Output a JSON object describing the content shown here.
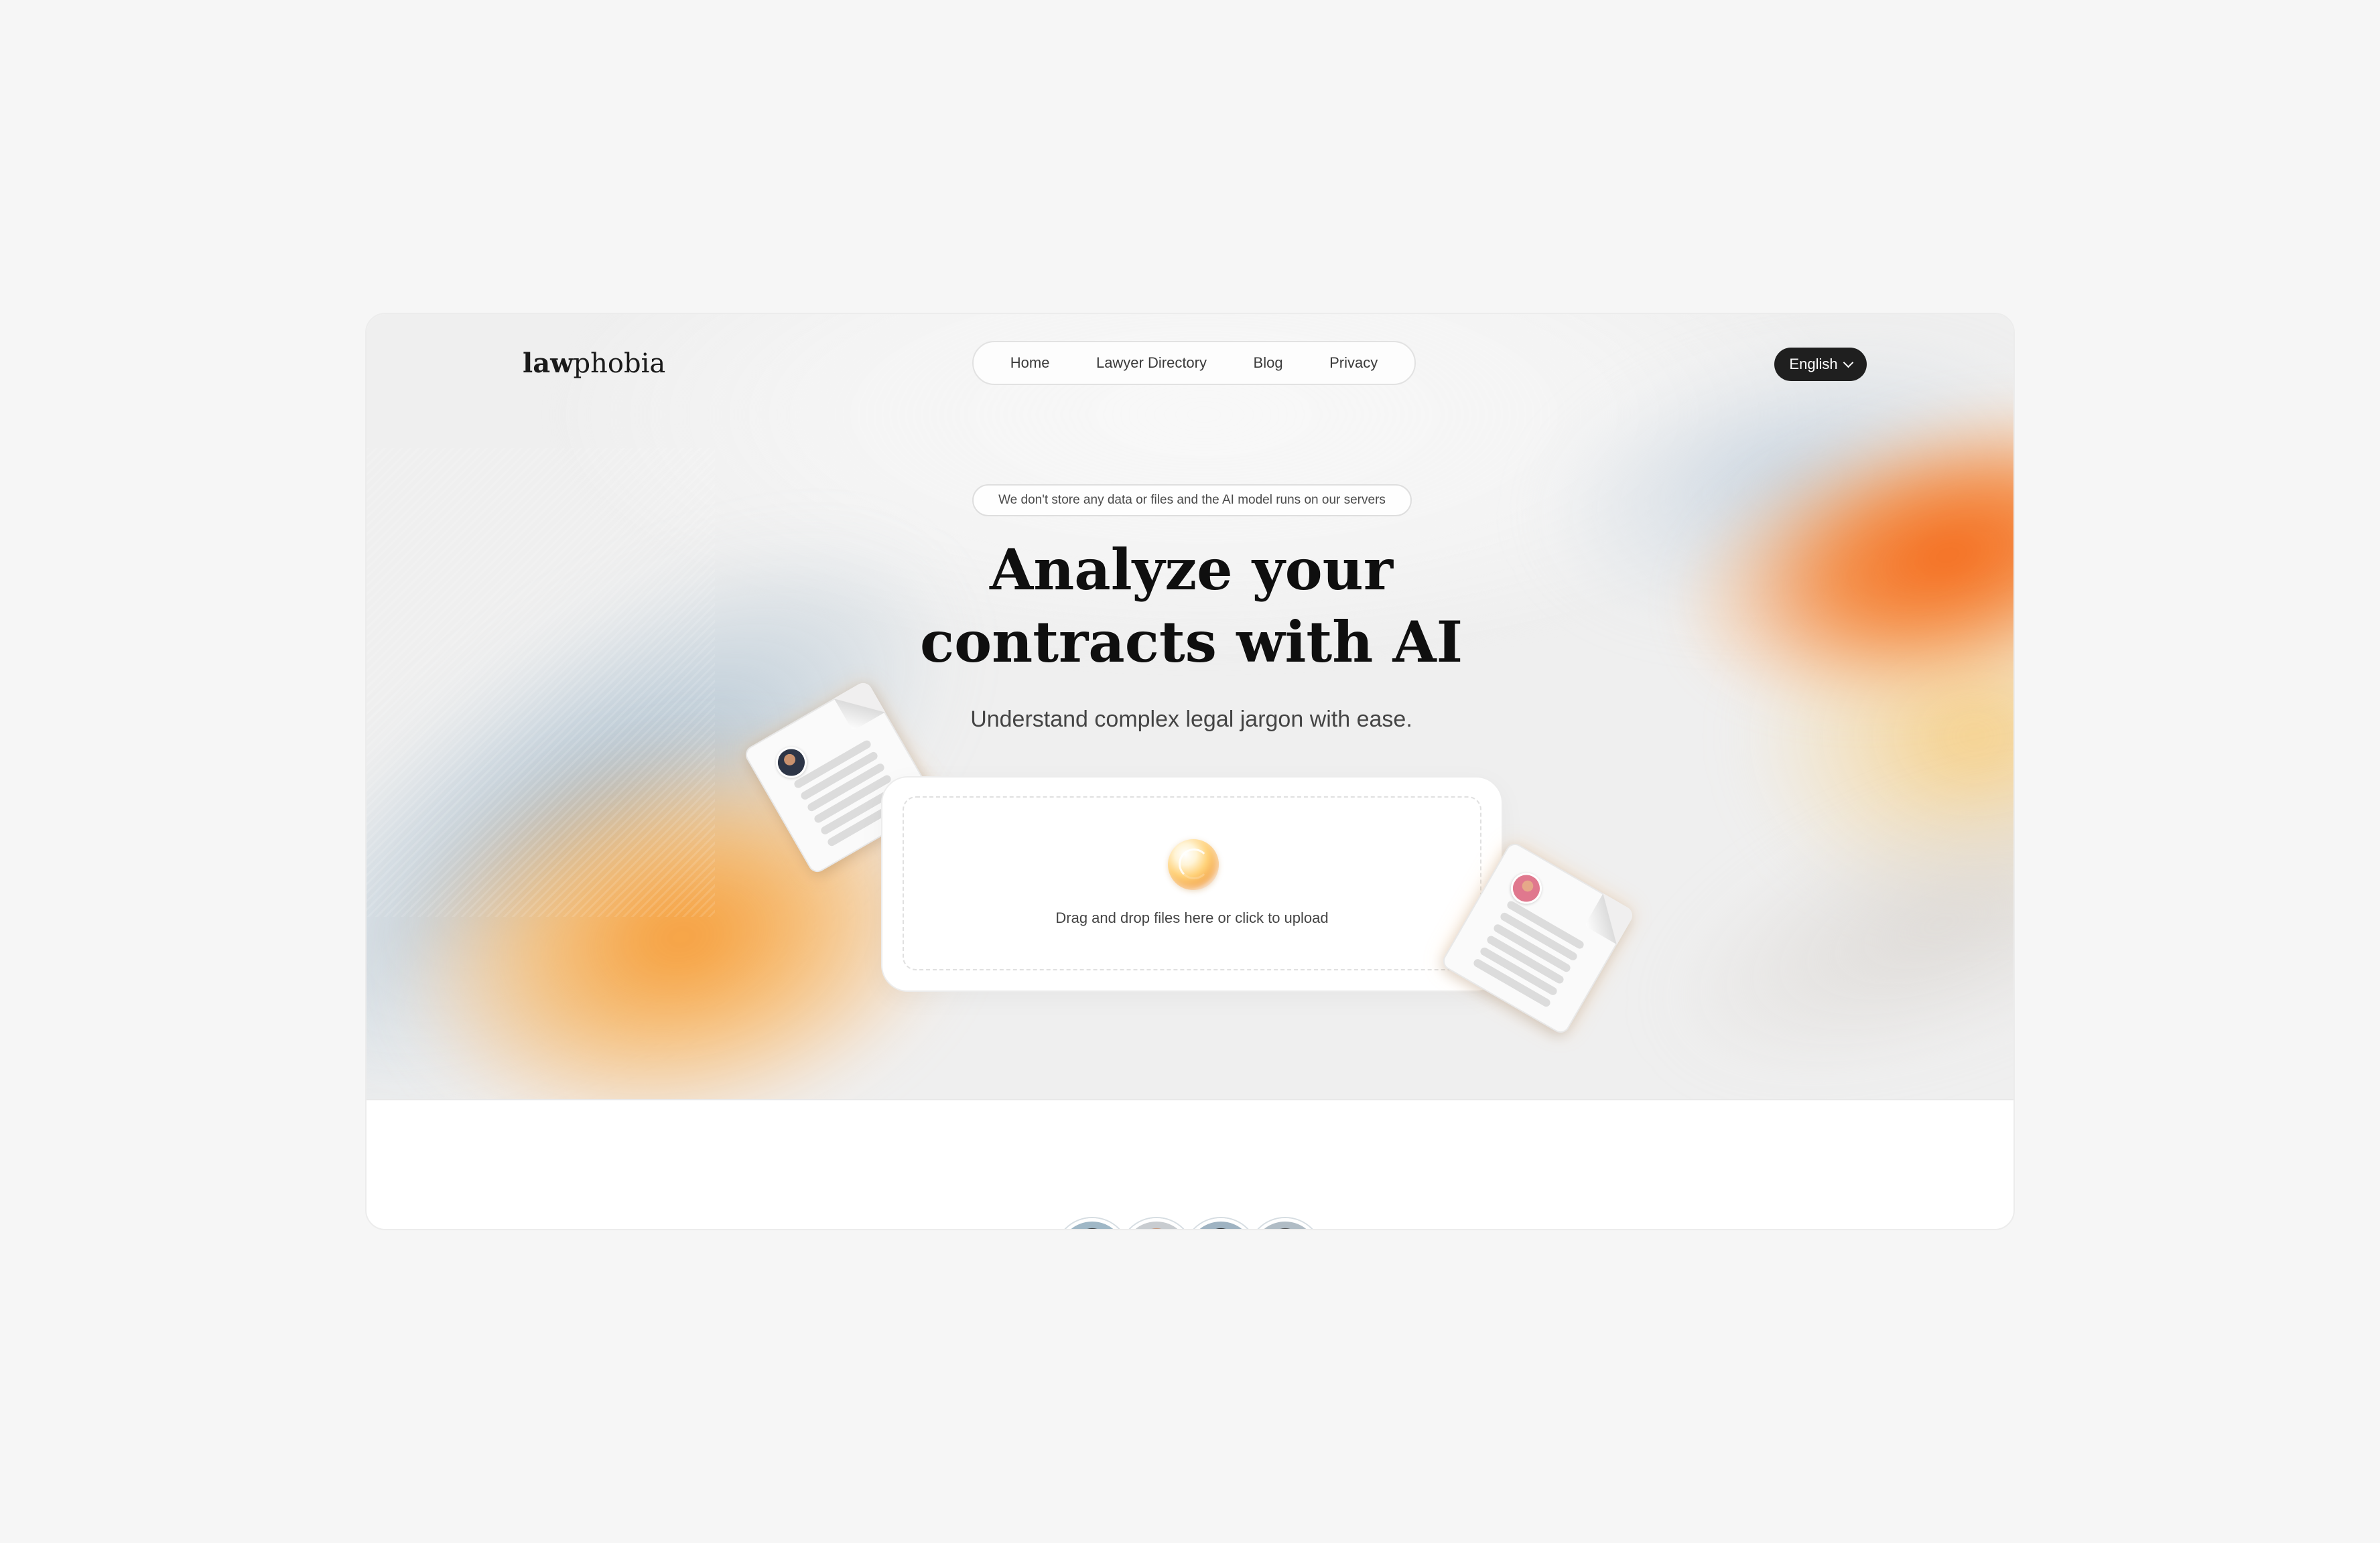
{
  "brand": {
    "logo_bold": "law",
    "logo_light": "phobia"
  },
  "nav": {
    "items": [
      {
        "label": "Home"
      },
      {
        "label": "Lawyer Directory"
      },
      {
        "label": "Blog"
      },
      {
        "label": "Privacy"
      }
    ]
  },
  "language": {
    "selected": "English",
    "icon": "chevron-down-icon"
  },
  "hero": {
    "notice": "We don't store any data or files and the AI model runs on our servers",
    "headline_line1": "Analyze your",
    "headline_line2": "contracts with AI",
    "subtitle": "Understand complex legal jargon with ease."
  },
  "upload": {
    "text": "Drag and drop files here or click to upload",
    "icon": "upload-orb-icon"
  },
  "colors": {
    "accent_orange": "#f47a2a",
    "accent_blue": "#9fb5c6",
    "dark": "#1f1f1f"
  }
}
